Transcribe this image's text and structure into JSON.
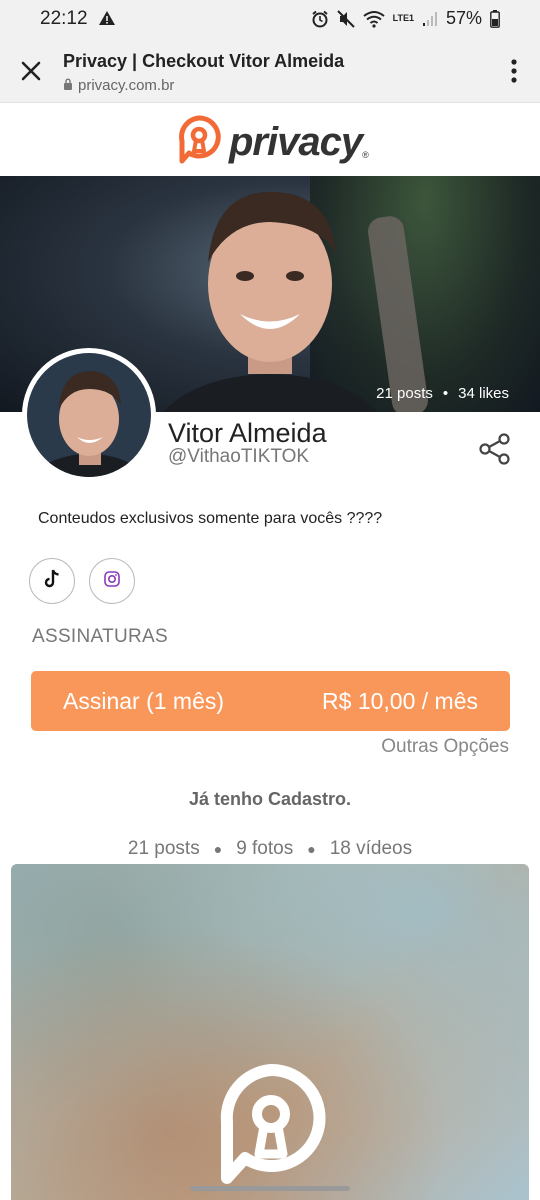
{
  "status_bar": {
    "time": "22:12",
    "battery": "57%",
    "network": "LTE1"
  },
  "browser": {
    "title": "Privacy | Checkout Vitor Almeida",
    "url": "privacy.com.br"
  },
  "brand": {
    "name": "privacy",
    "color": "#f26b36",
    "text_color": "#333333"
  },
  "cover": {
    "posts": "21 posts",
    "likes": "34 likes"
  },
  "profile": {
    "name": "Vitor Almeida",
    "handle": "@VithaoTIKTOK",
    "bio": "Conteudos exclusivos somente para vocês ????"
  },
  "social_links": [
    {
      "icon": "tiktok-icon"
    },
    {
      "icon": "instagram-icon"
    }
  ],
  "subscriptions": {
    "label": "ASSINATURAS",
    "button_left": "Assinar (1 mês)",
    "button_right": "R$ 10,00 / mês",
    "button_color": "#f9975a",
    "other_options": "Outras Opções"
  },
  "already_registered": "Já tenho Cadastro.",
  "content_counts": {
    "posts": "21 posts",
    "photos": "9 fotos",
    "videos": "18 vídeos"
  }
}
